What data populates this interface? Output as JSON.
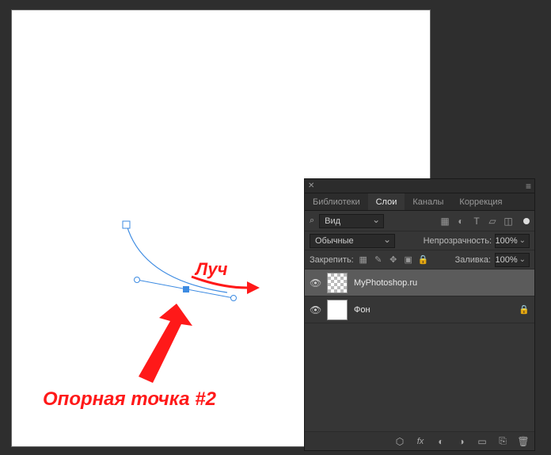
{
  "annotations": {
    "ray": "Луч",
    "anchor": "Опорная точка #2"
  },
  "panel": {
    "tabs": {
      "libraries": "Библиотеки",
      "layers": "Слои",
      "channels": "Каналы",
      "adjustments": "Коррекция"
    },
    "filter": {
      "label": "Вид"
    },
    "blend": {
      "mode": "Обычные",
      "opacity_label": "Непрозрачность:",
      "opacity_value": "100%"
    },
    "lock": {
      "label": "Закрепить:",
      "fill_label": "Заливка:",
      "fill_value": "100%"
    },
    "layers": [
      {
        "name": "MyPhotoshop.ru",
        "locked": false
      },
      {
        "name": "Фон",
        "locked": true
      }
    ]
  },
  "colors": {
    "annotation": "#ff1919",
    "anchor_fill": "#3d8be2",
    "path": "#3d8be2"
  }
}
